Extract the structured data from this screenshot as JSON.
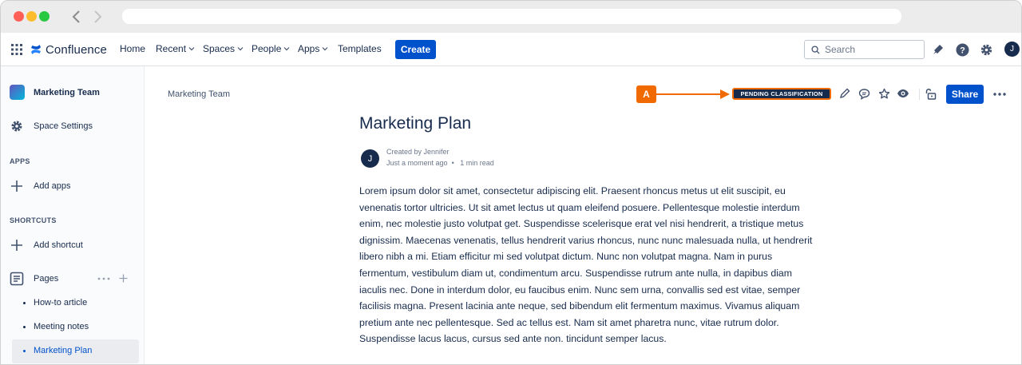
{
  "topnav": {
    "brand": "Confluence",
    "menu": [
      {
        "label": "Home",
        "dropdown": false
      },
      {
        "label": "Recent",
        "dropdown": true
      },
      {
        "label": "Spaces",
        "dropdown": true
      },
      {
        "label": "People",
        "dropdown": true
      },
      {
        "label": "Apps",
        "dropdown": true
      },
      {
        "label": "Templates",
        "dropdown": false
      }
    ],
    "create_label": "Create",
    "search_placeholder": "Search",
    "avatar_initial": "J"
  },
  "sidebar": {
    "space_name": "Marketing Team",
    "space_settings": "Space Settings",
    "apps_heading": "APPS",
    "add_apps": "Add apps",
    "shortcuts_heading": "SHORTCUTS",
    "add_shortcut": "Add shortcut",
    "pages_label": "Pages",
    "pages": [
      "How-to article",
      "Meeting notes",
      "Marketing Plan"
    ]
  },
  "main": {
    "breadcrumb": "Marketing Team",
    "callout_label": "A",
    "classification": "PENDING CLASSIFICATION",
    "share_label": "Share",
    "title": "Marketing Plan",
    "author_initial": "J",
    "created_by": "Created by Jennifer",
    "timestamp": "Just a moment ago",
    "read_time": "1 min read",
    "body_lines": [
      "Lorem ipsum dolor sit amet, consectetur adipiscing elit. Praesent rhoncus metus ut elit suscipit, eu",
      "venenatis tortor ultricies. Ut sit amet lectus ut quam eleifend posuere. Pellentesque molestie interdum",
      "enim, nec molestie justo volutpat get. Suspendisse scelerisque erat vel nisi hendrerit, a tristique metus",
      "dignissim. Maecenas venenatis, tellus hendrerit varius rhoncus, nunc nunc malesuada nulla, ut hendrerit",
      "libero nibh a mi. Etiam efficitur mi sed volutpat dictum. Nunc non volutpat magna. Nam in purus",
      "fermentum, vestibulum diam ut, condimentum arcu. Suspendisse rutrum ante nulla, in dapibus diam",
      "iaculis nec. Done in interdum dolor, eu faucibus enim. Nunc sem urna, convallis sed est vitae, semper",
      "facilisis magna. Present lacinia ante neque, sed bibendum elit fermentum maximus. Vivamus aliquam",
      "pretium ante nec pellentesque. Sed ac tellus est. Nam sit amet pharetra nunc, vitae rutrum dolor.",
      "Suspendisse lacus lacus, cursus sed ante non. tincidunt semper lacus."
    ]
  },
  "colors": {
    "primary": "#0052cc",
    "callout": "#f16a00",
    "text": "#172b4d"
  }
}
